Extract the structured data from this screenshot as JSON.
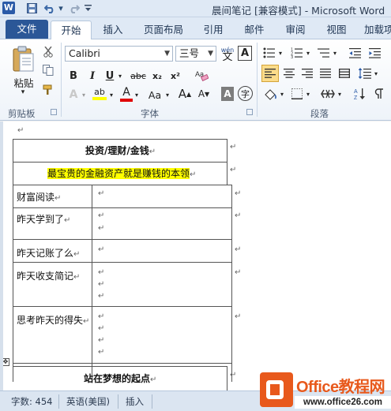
{
  "title_bar": {
    "window_title": "晨间笔记 [兼容模式] - Microsoft Word",
    "app_icon": "W",
    "quick_access": [
      "save-icon",
      "undo-icon",
      "redo-icon",
      "customize-icon"
    ]
  },
  "tabs": {
    "file": "文件",
    "items": [
      "开始",
      "插入",
      "页面布局",
      "引用",
      "邮件",
      "审阅",
      "视图",
      "加载项"
    ],
    "active": "开始"
  },
  "ribbon": {
    "clipboard": {
      "paste": "粘贴",
      "label": "剪贴板"
    },
    "font": {
      "font_name": "Calibri",
      "font_size": "三号",
      "phonetic_glyph": "wén",
      "border_glyph": "A",
      "bold": "B",
      "italic": "I",
      "underline": "U",
      "strike": "abc",
      "subscript": "x₂",
      "superscript": "x²",
      "text_effects": "A",
      "highlight": "ab",
      "font_color": "A",
      "change_case": "Aa",
      "grow": "A",
      "shrink": "A",
      "char_shade": "A",
      "enclose": "字",
      "label": "字体"
    },
    "paragraph": {
      "label": "段落"
    }
  },
  "document": {
    "return_mark": "↵",
    "title_row": "投资/理财/金钱",
    "motto_row": "最宝贵的金融资产就是赚钱的本领",
    "rows": [
      {
        "label": "财富阅读",
        "marks": 1
      },
      {
        "label": "昨天学到了",
        "marks": 2
      },
      {
        "label": "昨天记账了么",
        "marks": 1
      },
      {
        "label": "昨天收支简记",
        "marks": 3
      },
      {
        "label": "思考昨天的得失",
        "marks": 4
      }
    ],
    "next_title": "站在梦想的起点"
  },
  "status_bar": {
    "word_count": "字数: 454",
    "language": "英语(美国)",
    "mode": "插入"
  },
  "watermark": {
    "brand": "Office教程网",
    "url": "www.office26.com"
  },
  "colors": {
    "accent": "#2b5797",
    "highlight": "#ffff00",
    "watermark_orange": "#e8591c"
  }
}
